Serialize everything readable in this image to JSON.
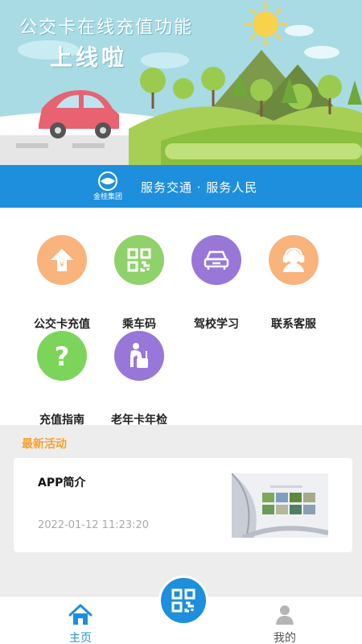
{
  "banner": {
    "title": "公交卡在线充值功能",
    "subtitle": "上线啦"
  },
  "strip": {
    "logo_text": "金桂集团",
    "slogan": "服务交通 · 服务人民"
  },
  "features": [
    {
      "label": "公交卡充值",
      "icon": "upload-arrow-yen-icon",
      "color": "#f9b37c"
    },
    {
      "label": "乘车码",
      "icon": "qr-code-icon",
      "color": "#8fd16a"
    },
    {
      "label": "驾校学习",
      "icon": "car-icon",
      "color": "#9877d9"
    },
    {
      "label": "联系客服",
      "icon": "headset-user-icon",
      "color": "#f9b37c"
    },
    {
      "label": "充值指南",
      "icon": "question-mark-icon",
      "color": "#7cd55a"
    },
    {
      "label": "老年卡年检",
      "icon": "elderly-check-icon",
      "color": "#9877d9"
    }
  ],
  "latest": {
    "section_title": "最新活动",
    "items": [
      {
        "title": "APP简介",
        "date": "2022-01-12 11:23:20"
      }
    ]
  },
  "bottom_nav": {
    "home_label": "主页",
    "mine_label": "我的",
    "accent": "#1e8fdc"
  }
}
